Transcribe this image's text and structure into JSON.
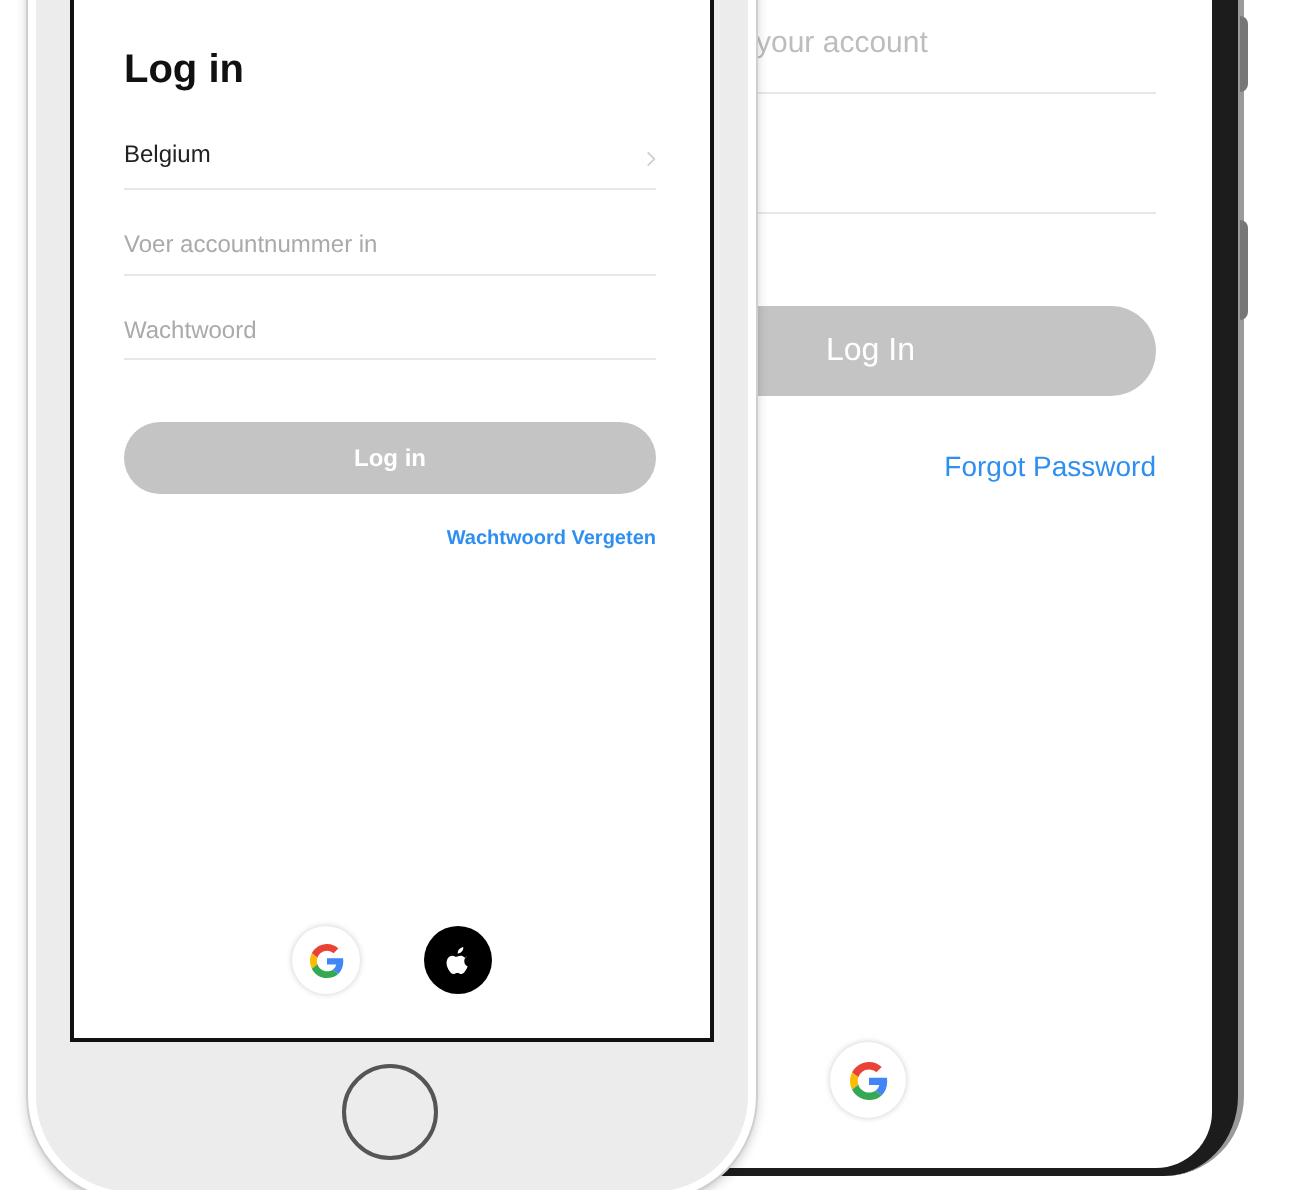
{
  "android_phone": {
    "account_field": {
      "placeholder": "your account"
    },
    "login_button": {
      "label": "Log In",
      "disabled": true
    },
    "forgot_link": "Forgot Password",
    "social_buttons": [
      {
        "kind": "google"
      }
    ]
  },
  "ios_phone": {
    "title": "Log in",
    "country_field": {
      "value": "Belgium"
    },
    "account_field": {
      "placeholder": "Voer accountnummer in"
    },
    "password_field": {
      "placeholder": "Wachtwoord"
    },
    "login_button": {
      "label": "Log in",
      "disabled": true
    },
    "forgot_link": "Wachtwoord Vergeten",
    "social_buttons": [
      {
        "kind": "google"
      },
      {
        "kind": "apple"
      }
    ]
  }
}
